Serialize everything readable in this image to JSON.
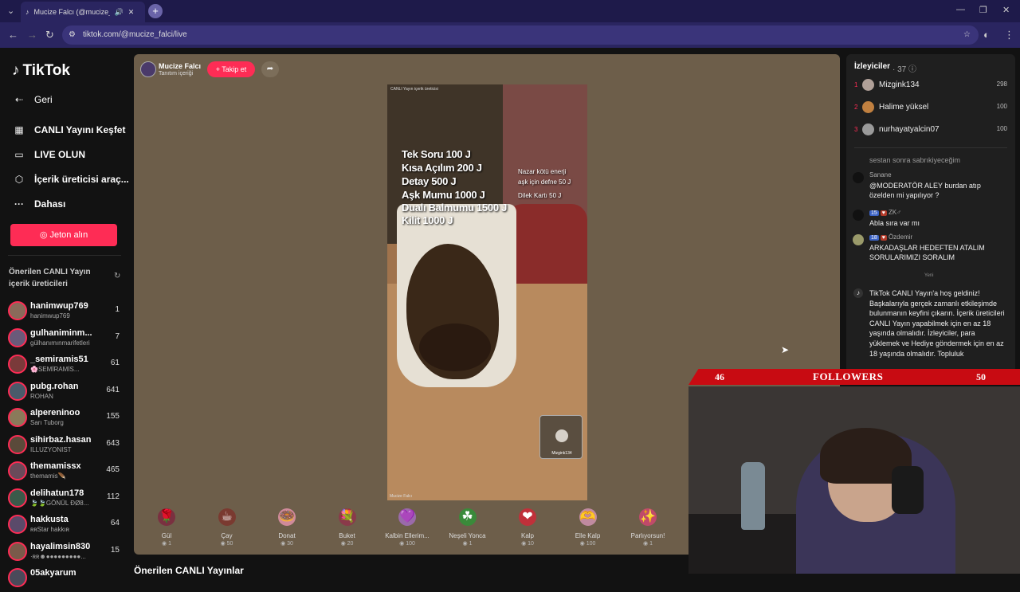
{
  "browser": {
    "tab_title": "Mucize Falcı (@mucize_falci",
    "url": "tiktok.com/@mucize_falci/live"
  },
  "sidebar": {
    "logo": "TikTok",
    "nav": [
      {
        "label": "Geri",
        "icon": "back-arrow-icon"
      },
      {
        "label": "CANLI Yayını Keşfet",
        "icon": "calendar-icon"
      },
      {
        "label": "LIVE OLUN",
        "icon": "camera-icon"
      },
      {
        "label": "İçerik üreticisi araç...",
        "icon": "creator-icon"
      },
      {
        "label": "Dahası",
        "icon": "more-icon"
      }
    ],
    "coin_button": "Jeton alın",
    "suggested_title": "Önerilen CANLI Yayın içerik üreticileri",
    "suggested": [
      {
        "name": "hanimwup769",
        "sub": "hanimwup769",
        "count": "1",
        "color": "#8a6a5a"
      },
      {
        "name": "gulhaniminm...",
        "sub": "gülhanımınmarifetleri",
        "count": "7",
        "color": "#6a5a7a"
      },
      {
        "name": "_semiramis51",
        "sub": "🌸SEMİRAMİS...",
        "count": "61",
        "color": "#7a3a3a"
      },
      {
        "name": "pubg.rohan",
        "sub": "ROHAN",
        "count": "641",
        "color": "#4a5a6a"
      },
      {
        "name": "alpereninoo",
        "sub": "Sarı Tuborg",
        "count": "155",
        "color": "#8a7a5a"
      },
      {
        "name": "sihirbaz.hasan",
        "sub": "ILLUZYONIST",
        "count": "643",
        "color": "#5a4a3a"
      },
      {
        "name": "themamissx",
        "sub": "themamis🪶",
        "count": "465",
        "color": "#6a4a5a"
      },
      {
        "name": "delihatun178",
        "sub": "🍃🍃GÖNÜL ĐØ8...",
        "count": "112",
        "color": "#3a5a4a"
      },
      {
        "name": "hakkusta",
        "sub": "ʀʀStar hakkıʀ",
        "count": "64",
        "color": "#5a4a6a"
      },
      {
        "name": "hayalimsin830",
        "sub": "·ʀʀ☻●●●●●●●●●...",
        "count": "15",
        "color": "#7a5a4a"
      },
      {
        "name": "05akyarum",
        "sub": "",
        "count": "",
        "color": "#4a4a5a"
      }
    ]
  },
  "stream": {
    "host_name": "Mucize Falcı",
    "host_sub": "Tanıtım içeriği",
    "follow_label": "+ Takip et",
    "video_tag": "CANLI Yayın içerik üreticisi",
    "video_footer": "Mucize Falcı",
    "price_lines": [
      "Tek Soru 100 J",
      "Kısa Açılım 200 J",
      "Detay 500 J",
      "Aşk Mumu 1000 J",
      "Dualı Balmumu 1500 J",
      "Kilit 1000 J"
    ],
    "side_lines": [
      "Nazar kötü enerji",
      "aşk için defne 50 J",
      "Dilek Kartı 50 J"
    ],
    "guest_name": "Mizgink134",
    "gifts": [
      {
        "name": "Gül",
        "price": "1",
        "icon": "🌹",
        "color": "#7a3040"
      },
      {
        "name": "Çay",
        "price": "50",
        "icon": "☕",
        "color": "#7a3a30"
      },
      {
        "name": "Donat",
        "price": "30",
        "icon": "🍩",
        "color": "#d08a9a"
      },
      {
        "name": "Buket",
        "price": "20",
        "icon": "💐",
        "color": "#8a3a4a"
      },
      {
        "name": "Kalbin Ellerim...",
        "price": "100",
        "icon": "💜",
        "color": "#9a6aaa"
      },
      {
        "name": "Neşeli Yonca",
        "price": "1",
        "icon": "☘",
        "color": "#3a8a3a"
      },
      {
        "name": "Kalp",
        "price": "10",
        "icon": "❤",
        "color": "#c0303a"
      },
      {
        "name": "Elle Kalp",
        "price": "100",
        "icon": "🫶",
        "color": "#c08aa0"
      },
      {
        "name": "Parlıyorsun!",
        "price": "1",
        "icon": "✨",
        "color": "#c04a6a"
      }
    ],
    "recommended_label": "Önerilen CANLI Yayınlar"
  },
  "viewers": {
    "title": "İzleyiciler",
    "count": "· 37",
    "list": [
      {
        "rank": "1",
        "name": "Mizgink134",
        "score": "298",
        "color": "#b0a098"
      },
      {
        "rank": "2",
        "name": "Halime yüksel",
        "score": "100",
        "color": "#c08040"
      },
      {
        "rank": "3",
        "name": "nurhayatyalcin07",
        "score": "100",
        "color": "#9a9a9a"
      }
    ]
  },
  "chat": {
    "faded": "sestan sonra sabrıkiyeceğim",
    "messages": [
      {
        "user": "Sanane",
        "text": "@MODERATÖR ALEY burdan atıp özelden mi yapılıyor ?",
        "badges": []
      },
      {
        "user": "ZK♂",
        "text": "Abla sıra var mı",
        "badges": [
          "15",
          "♥"
        ]
      },
      {
        "user": "Özdemir",
        "text": "ARKADAŞLAR HEDEFTEN ATALIM SORULARIMIZI SORALIM",
        "badges": [
          "18",
          "♥"
        ]
      }
    ],
    "new_label": "Yeni",
    "welcome": "TikTok CANLI Yayın'a hoş geldiniz! Başkalarıyla gerçek zamanlı etkileşimde bulunmanın keyfini çıkarın. İçerik üreticileri CANLI Yayın yapabilmek için en az 18 yaşında olmalıdır. İzleyiciler, para yüklemek ve Hediye göndermek için en az 18 yaşında olmalıdır. Topluluk"
  },
  "followers_goal": {
    "current": "46",
    "label": "FOLLOWERS",
    "target": "50",
    "color": "#c80b12"
  }
}
